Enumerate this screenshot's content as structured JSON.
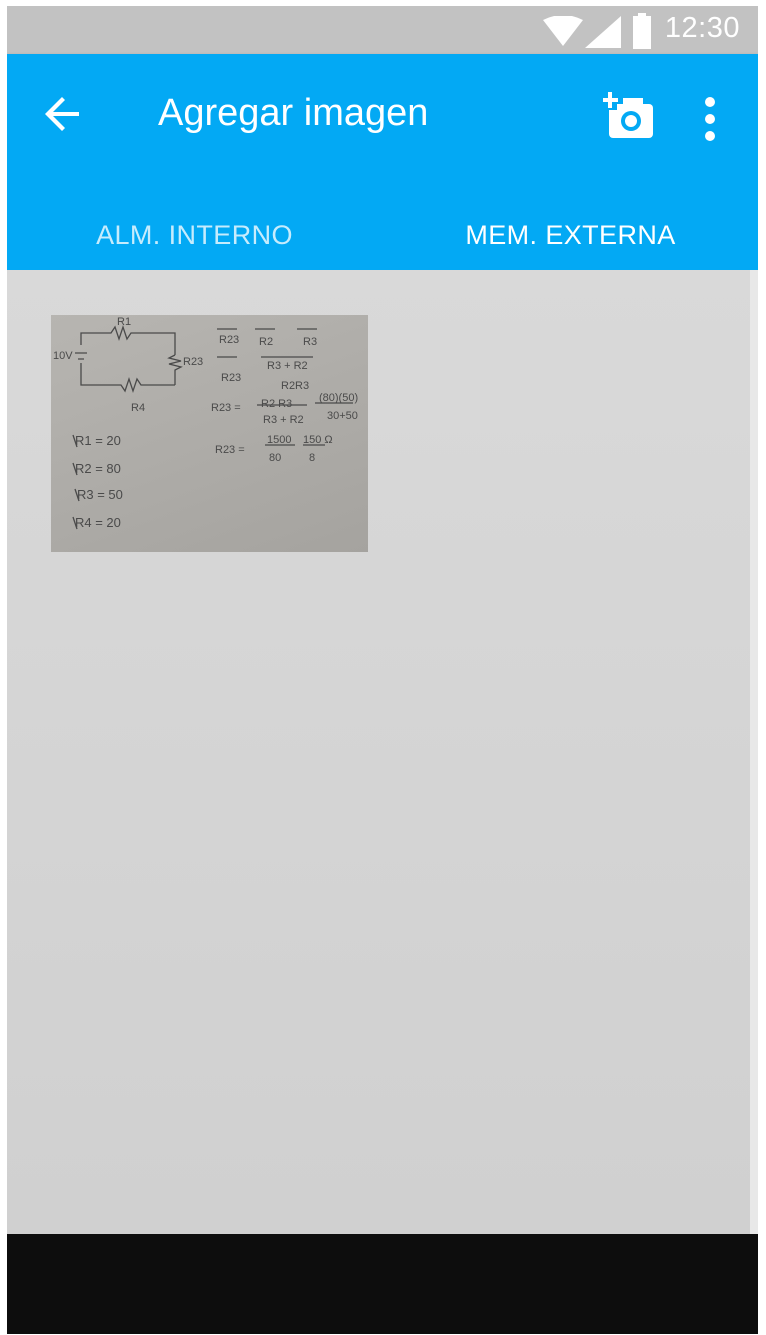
{
  "status_bar": {
    "time": "12:30",
    "icons": [
      "wifi-icon",
      "signal-icon",
      "battery-icon"
    ]
  },
  "app_bar": {
    "title": "Agregar imagen",
    "back_icon": "arrow-back-icon",
    "camera_icon": "add-photo-icon",
    "menu_icon": "more-vert-icon"
  },
  "tabs": [
    {
      "label": "ALM. INTERNO",
      "selected": false
    },
    {
      "label": "MEM. EXTERNA",
      "selected": true
    }
  ],
  "gallery": {
    "images": [
      {
        "content_lines": [
          "R1",
          "10V",
          "R23",
          "R4",
          "R1 = 20",
          "R2 = 80",
          "R3 = 50",
          "R4 = 20"
        ]
      }
    ]
  },
  "colors": {
    "app_bar": "#03a9f4",
    "status_bar": "#c2c2c2",
    "content_bg": "#d6d6d6",
    "nav_bar": "#0d0d0d"
  }
}
